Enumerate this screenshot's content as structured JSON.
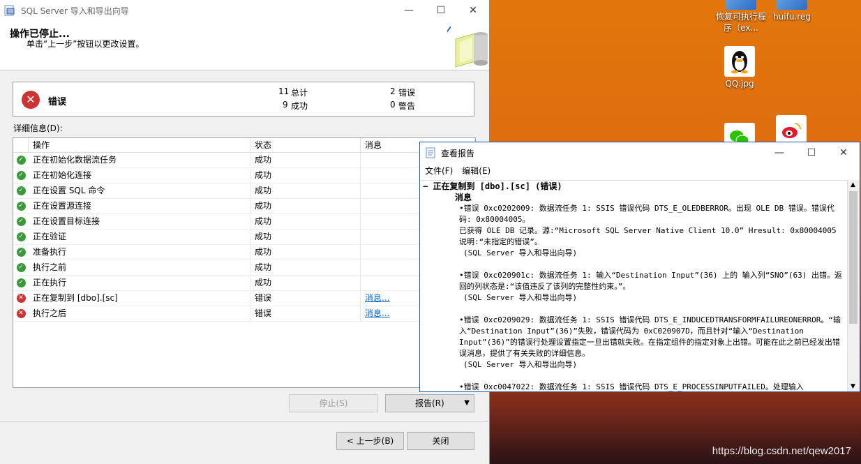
{
  "desktop": {
    "icons": [
      {
        "label": "恢复可执行程序（ex...",
        "icon": "exe-restore-icon"
      },
      {
        "label": "huifu.reg",
        "icon": "registry-file-icon"
      },
      {
        "label": "QQ.jpg",
        "icon": "qq-image-icon"
      },
      {
        "label": "",
        "icon": "wechat-icon"
      },
      {
        "label": "",
        "icon": "weibo-icon"
      }
    ],
    "watermark": "https://blog.csdn.net/qew2017"
  },
  "wizard": {
    "title": "SQL Server 导入和导出向导",
    "header_title": "操作已停止...",
    "header_subtitle": "单击“上一步”按钮以更改设置。",
    "status_label": "错误",
    "stats": {
      "total_value": "11",
      "total_label": "总计",
      "success_value": "9",
      "success_label": "成功",
      "error_value": "2",
      "error_label": "错误",
      "warning_value": "0",
      "warning_label": "警告"
    },
    "details_label": "详细信息(D):",
    "columns": [
      "操作",
      "状态",
      "消息"
    ],
    "rows": [
      {
        "action": "正在初始化数据流任务",
        "status": "成功",
        "message": "",
        "ok": true
      },
      {
        "action": "正在初始化连接",
        "status": "成功",
        "message": "",
        "ok": true
      },
      {
        "action": "正在设置 SQL 命令",
        "status": "成功",
        "message": "",
        "ok": true
      },
      {
        "action": "正在设置源连接",
        "status": "成功",
        "message": "",
        "ok": true
      },
      {
        "action": "正在设置目标连接",
        "status": "成功",
        "message": "",
        "ok": true
      },
      {
        "action": "正在验证",
        "status": "成功",
        "message": "",
        "ok": true
      },
      {
        "action": "准备执行",
        "status": "成功",
        "message": "",
        "ok": true
      },
      {
        "action": "执行之前",
        "status": "成功",
        "message": "",
        "ok": true
      },
      {
        "action": "正在执行",
        "status": "成功",
        "message": "",
        "ok": true
      },
      {
        "action": "正在复制到 [dbo].[sc]",
        "status": "错误",
        "message": "消息...",
        "ok": false
      },
      {
        "action": "执行之后",
        "status": "错误",
        "message": "消息...",
        "ok": false
      }
    ],
    "buttons": {
      "stop": "停止(S)",
      "report": "报告(R)",
      "back": "< 上一步(B)",
      "close": "关闭"
    }
  },
  "report": {
    "title": "查看报告",
    "menu": [
      "文件(F)",
      "编辑(E)"
    ],
    "heading": "正在复制到 [dbo].[sc] (错误)",
    "subheading": "消息",
    "entries": [
      {
        "lines": [
          "•错误 0xc0202009: 数据流任务 1: SSIS 错误代码 DTS_E_OLEDBERROR。出现 OLE DB 错误。错误代码: 0x80004005。",
          "已获得 OLE DB 记录。源:“Microsoft SQL Server Native Client 10.0” Hresult: 0x80004005 说明:“未指定的错误”。",
          "(SQL Server 导入和导出向导)"
        ]
      },
      {
        "lines": [
          "•错误 0xc020901c: 数据流任务 1: 输入“Destination Input”(36) 上的 输入列“SNO”(63) 出错。返回的列状态是:“该值违反了该列的完整性约束。”。",
          "(SQL Server 导入和导出向导)"
        ]
      },
      {
        "lines": [
          "•错误 0xc0209029: 数据流任务 1: SSIS 错误代码 DTS_E_INDUCEDTRANSFORMFAILUREONERROR。“输入“Destination Input”(36)”失败，错误代码为 0xC020907D，而且针对“输入“Destination Input”(36)”的错误行处理设置指定一旦出错就失败。在指定组件的指定对象上出错。可能在此之前已经发出错误消息，提供了有关失败的详细信息。",
          "(SQL Server 导入和导出向导)"
        ]
      },
      {
        "lines": [
          "•错误 0xc0047022: 数据流任务 1: SSIS 错误代码 DTS_E_PROCESSINPUTFAILED。处理输入"
        ]
      }
    ]
  }
}
